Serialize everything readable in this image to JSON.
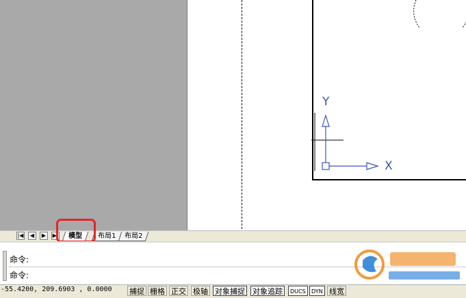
{
  "ucs": {
    "x_label": "X",
    "y_label": "Y"
  },
  "layout_tabs": {
    "nav_buttons": [
      "first-tab",
      "prev-tab",
      "next-tab",
      "last-tab"
    ],
    "tabs": [
      {
        "label": "模型",
        "active": true
      },
      {
        "label": "布局1",
        "active": false
      },
      {
        "label": "布局2",
        "active": false
      }
    ]
  },
  "command": {
    "line1_prompt": "命令:",
    "line2_prompt": "命令:"
  },
  "status": {
    "coordinates": "-55.4200, 209.6903 , 0.0000",
    "buttons": [
      {
        "label": "捕捉",
        "on": false
      },
      {
        "label": "栅格",
        "on": false
      },
      {
        "label": "正交",
        "on": false
      },
      {
        "label": "极轴",
        "on": false
      },
      {
        "label": "对象捕捉",
        "on": true
      },
      {
        "label": "对象追踪",
        "on": true
      },
      {
        "label": "DUCS",
        "on": true
      },
      {
        "label": "DYN",
        "on": true
      },
      {
        "label": "线宽",
        "on": false
      }
    ]
  },
  "colors": {
    "highlight": "#e0262b",
    "paper_space_gray": "#a9a9a9",
    "ucs_blue": "#3a55b5",
    "watermark_orange": "#f08a1c",
    "watermark_blue": "#1f7bd6"
  }
}
